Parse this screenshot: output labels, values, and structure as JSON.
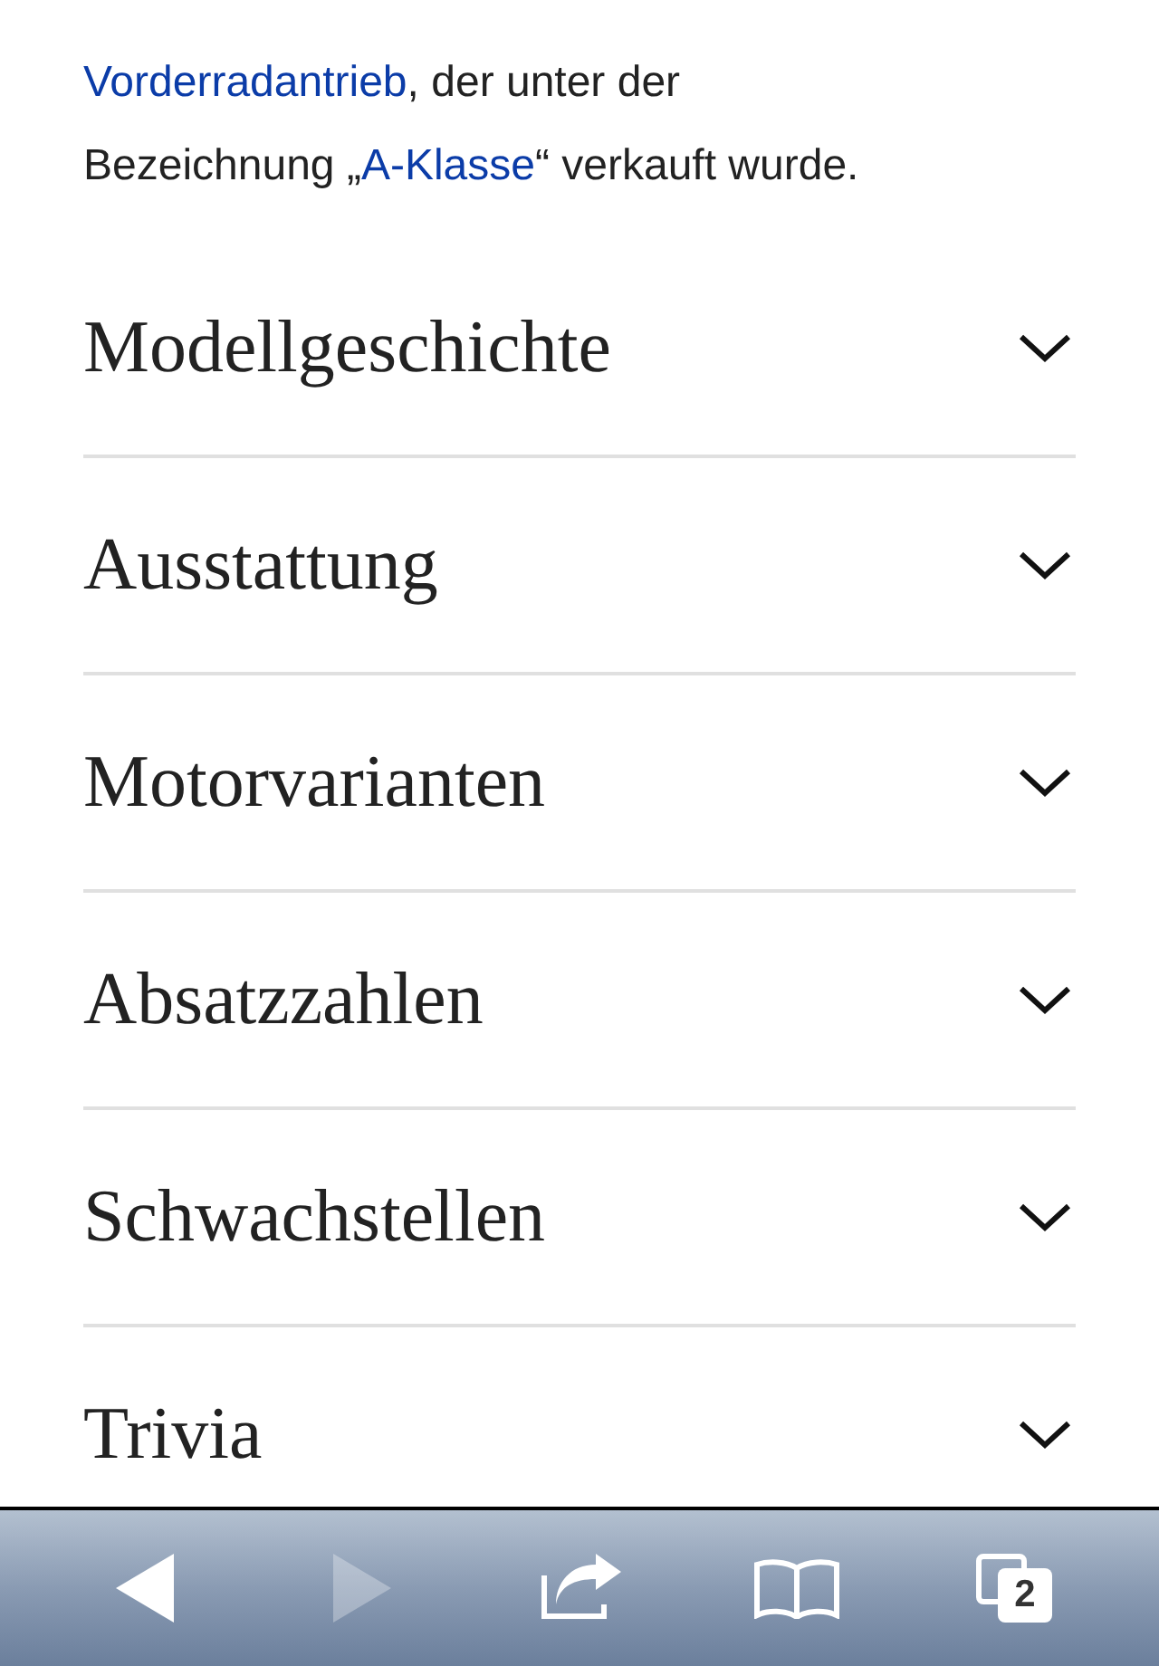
{
  "intro": [
    {
      "text": "Vorderradantrieb",
      "link": true
    },
    {
      "text": ", der unter der",
      "link": false,
      "line_break": true
    },
    {
      "text": "Bezeichnung „",
      "link": false
    },
    {
      "text": "A-Klasse",
      "link": true
    },
    {
      "text": "“ verkauft wurde.",
      "link": false
    }
  ],
  "sections": [
    {
      "title": "Modellgeschichte",
      "expanded": false
    },
    {
      "title": "Ausstattung",
      "expanded": false
    },
    {
      "title": "Motorvarianten",
      "expanded": false
    },
    {
      "title": "Absatzzahlen",
      "expanded": false
    },
    {
      "title": "Schwachstellen",
      "expanded": false
    },
    {
      "title": "Trivia",
      "expanded": false
    }
  ],
  "toolbar": [
    {
      "kind": "back",
      "disabled": false
    },
    {
      "kind": "forward",
      "disabled": true
    },
    {
      "kind": "share",
      "disabled": false
    },
    {
      "kind": "bookmarks",
      "disabled": false
    },
    {
      "kind": "tabs",
      "disabled": false,
      "count": "2"
    }
  ]
}
